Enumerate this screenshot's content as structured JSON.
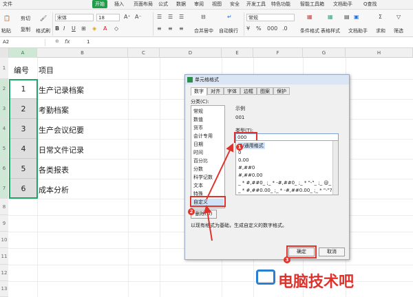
{
  "menu": {
    "file": "文件",
    "items": [
      "开始",
      "插入",
      "页面布局",
      "公式",
      "数据",
      "审阅",
      "视图",
      "安全",
      "开发工具",
      "特色功能",
      "智能工具箱",
      "文档助手"
    ],
    "search": "Q查找"
  },
  "ribbon": {
    "cut": "剪切",
    "paste": "粘贴",
    "copy": "复制",
    "format_painter": "格式刷",
    "font_name": "宋体",
    "font_size": "18",
    "number_format": "常规",
    "merge_center": "合并居中",
    "auto_wrap": "自动换行",
    "conditional_format": "条件格式",
    "table_style": "表格样式",
    "doc_helper": "文档助手",
    "sum": "求和",
    "filter": "筛选"
  },
  "formula_bar": {
    "cell_ref": "A2",
    "fx": "fx",
    "value": "1"
  },
  "columns": [
    "A",
    "B",
    "C",
    "D",
    "E",
    "F",
    "G",
    "H"
  ],
  "rows": [
    "1",
    "2",
    "3",
    "4",
    "5",
    "6",
    "7",
    "8",
    "9",
    "10",
    "11",
    "12",
    "13",
    "14"
  ],
  "table": {
    "header_no": "编号",
    "header_item": "项目",
    "rows": [
      {
        "no": "1",
        "item": "生产记录档案"
      },
      {
        "no": "2",
        "item": "考勤档案"
      },
      {
        "no": "3",
        "item": "生产会议纪要"
      },
      {
        "no": "4",
        "item": "日常文件记录"
      },
      {
        "no": "5",
        "item": "各类报表"
      },
      {
        "no": "6",
        "item": "成本分析"
      }
    ]
  },
  "dialog": {
    "title": "单元格格式",
    "tabs": [
      "数字",
      "对齐",
      "字体",
      "边框",
      "图案",
      "保护"
    ],
    "category_label": "分类(C):",
    "categories": [
      "常规",
      "数值",
      "货币",
      "会计专用",
      "日期",
      "时间",
      "百分比",
      "分数",
      "科学记数",
      "文本",
      "特殊",
      "自定义"
    ],
    "sample_label": "示例",
    "sample_value": "001",
    "type_label": "类型(T):",
    "type_value": "000",
    "formats": [
      "G/通用格式",
      "0",
      "0.00",
      "#,##0",
      "#,##0.00",
      "_ * #,##0_ ;_ * -#,##0_ ;_ * \"-\"_ ;_ @_",
      "_ * #,##0.00_ ;_ * -#,##0.00_ ;_ * \"-\"??_ ;_ @_"
    ],
    "delete_button": "删除(D)",
    "hint": "以现有格式为基础，生成自定义的数字格式。",
    "ok": "确定",
    "cancel": "取消",
    "badges": [
      "1",
      "2",
      "3"
    ]
  },
  "watermark": {
    "text": "电脑技术吧"
  },
  "colors": {
    "accent_green": "#1f9e4a",
    "annotation_red": "#e0322b",
    "selection_border": "#21a366"
  }
}
